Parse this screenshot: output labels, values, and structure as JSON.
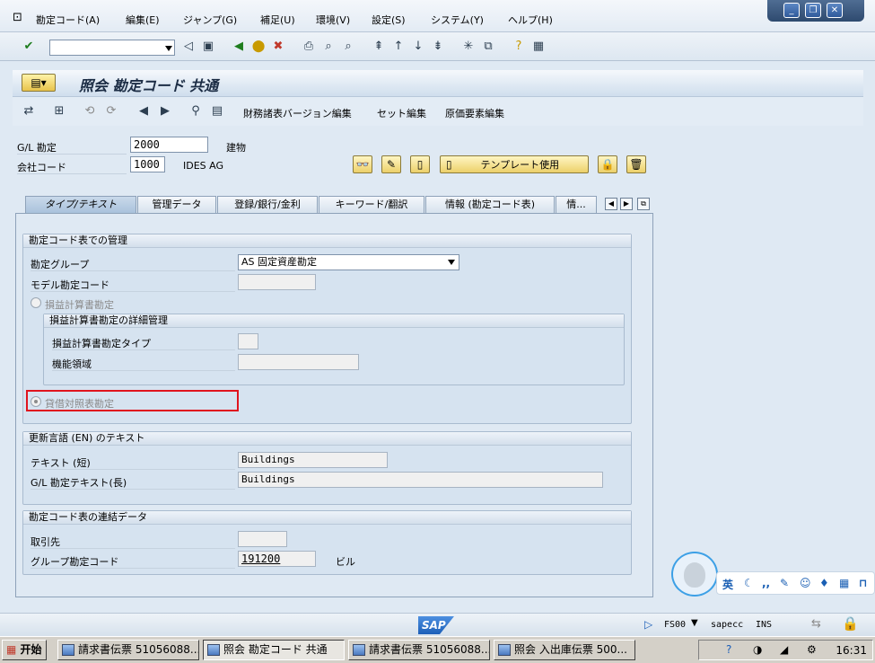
{
  "menu": {
    "items": [
      "勘定コード(A)",
      "編集(E)",
      "ジャンプ(G)",
      "補足(U)",
      "環境(V)",
      "設定(S)",
      "システム(Y)",
      "ヘルプ(H)"
    ]
  },
  "toolbar": {
    "command_value": ""
  },
  "title": {
    "text": "照会 勘定コード 共通"
  },
  "app_toolbar": {
    "fin_statement_edit": "財務諸表バージョン編集",
    "set_edit": "セット編集",
    "cost_element_edit": "原価要素編集"
  },
  "header": {
    "gl_account_label": "G/L 勘定",
    "gl_account_value": "2000",
    "gl_account_desc": "建物",
    "company_code_label": "会社コード",
    "company_code_value": "1000",
    "company_code_desc": "IDES AG",
    "template_button": "テンプレート使用"
  },
  "tabs": [
    {
      "label": "タイプ/テキスト",
      "active": true
    },
    {
      "label": "管理データ",
      "active": false
    },
    {
      "label": "登録/銀行/金利",
      "active": false
    },
    {
      "label": "キーワード/翻訳",
      "active": false
    },
    {
      "label": "情報 (勘定コード表)",
      "active": false
    },
    {
      "label": "情...",
      "active": false
    }
  ],
  "coa_control": {
    "title": "勘定コード表での管理",
    "account_group_label": "勘定グループ",
    "account_group_value": "AS 固定資産勘定",
    "sample_account_label": "モデル勘定コード",
    "sample_account_value": "",
    "pl_radio_label": "損益計算書勘定",
    "pl_detail": {
      "title": "損益計算書勘定の詳細管理",
      "pl_type_label": "損益計算書勘定タイプ",
      "pl_type_value": "",
      "func_area_label": "機能領域",
      "func_area_value": ""
    },
    "bs_radio_label": "貸借対照表勘定",
    "bs_selected": true
  },
  "texts": {
    "title": "更新言語 (EN) のテキスト",
    "short_label": "テキスト (短)",
    "short_value": "Buildings",
    "long_label": "G/L 勘定テキスト(長)",
    "long_value": "Buildings"
  },
  "consolidation": {
    "title": "勘定コード表の連結データ",
    "trading_partner_label": "取引先",
    "trading_partner_value": "",
    "group_account_label": "グループ勘定コード",
    "group_account_value": "191200",
    "group_account_desc": "ビル"
  },
  "status": {
    "logo": "SAP",
    "transaction": "FS00",
    "server": "sapecc",
    "mode": "INS"
  },
  "taskbar": {
    "start": "开始",
    "tasks": [
      {
        "label": "請求書伝票 51056088...",
        "pressed": false
      },
      {
        "label": "照会 勘定コード 共通",
        "pressed": true
      },
      {
        "label": "請求書伝票 51056088...",
        "pressed": false
      },
      {
        "label": "照会 入出庫伝票 500...",
        "pressed": false
      }
    ],
    "clock": "16:31"
  },
  "ime": {
    "lang": "英"
  },
  "colors": {
    "highlight_box": "#e0141e",
    "accent": "#1c5fb8"
  }
}
